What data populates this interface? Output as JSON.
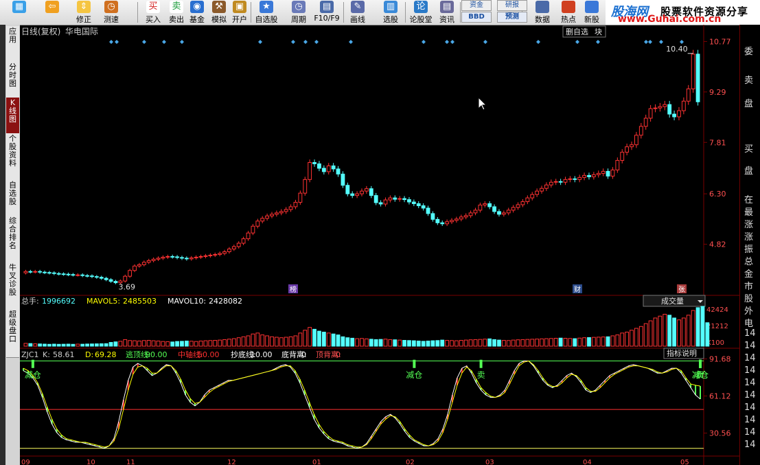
{
  "toolbar": {
    "buttons": [
      {
        "label": "",
        "icon": "window-grid-icon"
      },
      {
        "label": "",
        "icon": "back-arrow-icon"
      },
      {
        "label": "修正",
        "icon": "arrows-updown-icon"
      },
      {
        "label": "测速",
        "icon": "clock-icon"
      },
      {
        "label": "买入",
        "icon": "buy-icon"
      },
      {
        "label": "卖出",
        "icon": "sell-icon"
      },
      {
        "label": "基金",
        "icon": "fund-icon"
      },
      {
        "label": "模拟",
        "icon": "hammer-icon"
      },
      {
        "label": "开户",
        "icon": "lock-icon"
      },
      {
        "label": "自选股",
        "icon": "star-icon"
      },
      {
        "label": "周期",
        "icon": "cycle-clock-icon"
      },
      {
        "label": "F10/F9",
        "icon": "report-icon"
      },
      {
        "label": "画线",
        "icon": "pencil-icon"
      },
      {
        "label": "选股",
        "icon": "stock-pick-icon"
      },
      {
        "label": "论股堂",
        "icon": "forum-icon"
      },
      {
        "label": "资讯",
        "icon": "news-icon"
      }
    ],
    "stacked": [
      {
        "top": "资金",
        "bottom": "BBD"
      },
      {
        "top": "研报",
        "bottom": "预测"
      }
    ],
    "tail": [
      {
        "label": "数据",
        "icon": "pe-data-icon"
      },
      {
        "label": "热点",
        "icon": "hot-icon"
      },
      {
        "label": "新股",
        "icon": "new-stock-icon"
      }
    ],
    "brand": {
      "logo": "股海网",
      "slogan": "股票软件资源分享",
      "url": "www.Guhai.com.cn"
    }
  },
  "sidebar": {
    "items": [
      {
        "label": "应用",
        "active": false
      },
      {
        "label": "分时图",
        "active": false
      },
      {
        "label": "K线图",
        "active": true
      },
      {
        "label": "个股资料",
        "active": false
      },
      {
        "label": "自选股",
        "active": false
      },
      {
        "label": "综合排名",
        "active": false
      },
      {
        "label": "牛叉诊股",
        "active": false
      },
      {
        "label": "超级盘口",
        "active": false
      }
    ]
  },
  "chart_header": {
    "period": "日线(复权)",
    "stock_name": "华电国际",
    "delete_fav": "删自选",
    "market_suffix": "块"
  },
  "rightpanel": {
    "chars": [
      "委",
      "卖",
      "盘",
      "买",
      "盘",
      "在",
      "最",
      "涨",
      "涨",
      "振",
      "总",
      "金",
      "市",
      "股",
      "外",
      "电"
    ]
  },
  "price_axis": {
    "labels": [
      "10.77",
      "9.29",
      "7.81",
      "6.30",
      "4.82"
    ]
  },
  "price_annotations": {
    "high": "10.40",
    "low": "3.69"
  },
  "markers": {
    "bang": "榜",
    "cai": "财",
    "zhang": "张"
  },
  "volume_panel": {
    "total_label": "总手:",
    "total_value": "1996692",
    "mavol5_label": "MAVOL5:",
    "mavol5_value": "2485503",
    "mavol10_label": "MAVOL10:",
    "mavol10_value": "2428082",
    "selector": "成交量",
    "axis": [
      "42424",
      "21212",
      "X100"
    ]
  },
  "indicator_panel": {
    "name": "ZJC1",
    "k_label": "K:",
    "k_value": "58.61",
    "d_label": "D:",
    "d_value": "69.28",
    "escape_label": "逃顶线:",
    "escape_value": "90.00",
    "mid_label": "中轴线:",
    "mid_value": "50.00",
    "bottom_label": "抄底线:",
    "bottom_value": "10.00",
    "dib_label": "底背离:",
    "dib_value": "0",
    "dingb_label": "顶背离:",
    "dingb_value": "0",
    "help": "指标说明",
    "axis": [
      "91.68",
      "61.12",
      "30.56"
    ],
    "signals": [
      "减仓",
      "减仓",
      "卖",
      "卖",
      "减仓",
      "卖",
      "减仓"
    ]
  },
  "right_axis_rows": [
    "14",
    "14",
    "14",
    "14",
    "14",
    "14",
    "14",
    "14",
    "14",
    "14"
  ],
  "x_axis": {
    "labels": [
      "09",
      "10",
      "11",
      "12",
      "01",
      "02",
      "03",
      "04",
      "05"
    ]
  },
  "colors": {
    "up": "#ff3232",
    "down": "#54ffff",
    "grid": "#7a0000",
    "ma5": "#ffffff",
    "ma10": "#ffff00"
  },
  "chart_data": {
    "type": "candlestick",
    "price_range": [
      3.4,
      10.9
    ],
    "volume_range": [
      0,
      42424
    ],
    "indicator_range": [
      15,
      92
    ],
    "close_series": [
      4.02,
      4.01,
      4.02,
      4.0,
      3.99,
      3.98,
      3.96,
      3.95,
      3.94,
      3.93,
      3.92,
      3.92,
      3.9,
      3.89,
      3.87,
      3.85,
      3.82,
      3.78,
      3.73,
      3.69,
      3.74,
      3.88,
      4.05,
      4.18,
      4.22,
      4.29,
      4.34,
      4.38,
      4.41,
      4.44,
      4.46,
      4.45,
      4.43,
      4.41,
      4.39,
      4.42,
      4.44,
      4.46,
      4.48,
      4.5,
      4.52,
      4.55,
      4.6,
      4.68,
      4.75,
      4.85,
      4.98,
      5.15,
      5.35,
      5.5,
      5.58,
      5.65,
      5.7,
      5.74,
      5.78,
      5.84,
      5.92,
      6.05,
      6.32,
      6.72,
      7.22,
      7.18,
      7.05,
      6.95,
      7.12,
      7.03,
      6.88,
      6.55,
      6.3,
      6.25,
      6.3,
      6.38,
      6.45,
      6.25,
      6.04,
      6.0,
      6.12,
      6.18,
      6.14,
      6.16,
      6.13,
      6.06,
      6.01,
      5.95,
      5.88,
      5.72,
      5.55,
      5.45,
      5.42,
      5.48,
      5.52,
      5.56,
      5.62,
      5.66,
      5.74,
      5.82,
      5.97,
      6.01,
      5.92,
      5.78,
      5.7,
      5.74,
      5.82,
      5.9,
      5.98,
      6.07,
      6.18,
      6.28,
      6.38,
      6.46,
      6.56,
      6.64,
      6.66,
      6.64,
      6.72,
      6.74,
      6.72,
      6.78,
      6.84,
      6.8,
      6.86,
      6.9,
      6.96,
      6.82,
      7.0,
      7.28,
      7.52,
      7.68,
      7.74,
      8.02,
      8.28,
      8.52,
      8.8,
      8.82,
      8.86,
      8.92,
      8.64,
      8.56,
      8.74,
      9.02,
      9.38,
      10.4,
      9.0
    ],
    "volume_series": [
      30,
      28,
      25,
      24,
      22,
      20,
      22,
      20,
      21,
      22,
      20,
      22,
      21,
      23,
      24,
      25,
      26,
      27,
      40,
      46,
      52,
      70,
      60,
      58,
      55,
      60,
      62,
      58,
      55,
      50,
      48,
      45,
      50,
      52,
      55,
      53,
      50,
      55,
      58,
      60,
      62,
      65,
      70,
      75,
      80,
      90,
      100,
      110,
      130,
      140,
      120,
      110,
      100,
      95,
      90,
      95,
      100,
      110,
      140,
      170,
      200,
      180,
      160,
      150,
      140,
      130,
      120,
      100,
      90,
      85,
      80,
      82,
      78,
      74,
      70,
      72,
      75,
      70,
      68,
      65,
      62,
      60,
      58,
      55,
      52,
      55,
      58,
      60,
      65,
      62,
      60,
      58,
      62,
      65,
      68,
      70,
      72,
      75,
      78,
      70,
      65,
      62,
      60,
      65,
      68,
      70,
      72,
      74,
      76,
      78,
      80,
      82,
      84,
      86,
      84,
      82,
      80,
      86,
      90,
      92,
      94,
      96,
      98,
      100,
      110,
      120,
      140,
      150,
      170,
      190,
      210,
      240,
      270,
      300,
      320,
      340,
      330,
      300,
      280,
      300,
      330,
      380,
      410,
      424,
      250
    ],
    "k_series": [
      82,
      80,
      76,
      70,
      60,
      48,
      38,
      31,
      27,
      25,
      24,
      23,
      23,
      22,
      21,
      20,
      19,
      18,
      20,
      26,
      40,
      58,
      74,
      85,
      88,
      86,
      82,
      78,
      80,
      84,
      87,
      86,
      80,
      72,
      62,
      56,
      53,
      56,
      62,
      66,
      68,
      70,
      72,
      74,
      74,
      75,
      76,
      77,
      78,
      79,
      80,
      81,
      82,
      84,
      86,
      87,
      85,
      80,
      72,
      62,
      52,
      42,
      35,
      30,
      26,
      24,
      23,
      22,
      20,
      19,
      18,
      19,
      22,
      28,
      34,
      40,
      44,
      46,
      43,
      38,
      32,
      27,
      24,
      22,
      20,
      20,
      22,
      26,
      34,
      46,
      62,
      76,
      84,
      86,
      80,
      72,
      66,
      62,
      60,
      60,
      62,
      66,
      74,
      82,
      88,
      90,
      90,
      86,
      80,
      74,
      70,
      68,
      70,
      74,
      78,
      80,
      77,
      72,
      66,
      64,
      66,
      70,
      74,
      78,
      80,
      82,
      84,
      86,
      87,
      86,
      85,
      84,
      82,
      80,
      80,
      82,
      84,
      84,
      80,
      74,
      68,
      62,
      58.61
    ],
    "d_series": [
      84,
      82,
      78,
      72,
      63,
      52,
      42,
      34,
      29,
      26,
      25,
      24,
      23,
      23,
      22,
      21,
      20,
      19,
      20,
      24,
      34,
      50,
      66,
      79,
      85,
      86,
      84,
      80,
      80,
      83,
      86,
      86,
      82,
      75,
      66,
      59,
      55,
      56,
      60,
      64,
      67,
      69,
      71,
      73,
      74,
      75,
      76,
      77,
      78,
      79,
      80,
      81,
      82,
      83,
      85,
      86,
      86,
      82,
      75,
      66,
      56,
      46,
      38,
      32,
      28,
      25,
      24,
      23,
      21,
      20,
      19,
      19,
      21,
      26,
      32,
      38,
      42,
      45,
      44,
      40,
      34,
      29,
      25,
      23,
      21,
      20,
      21,
      24,
      31,
      42,
      56,
      70,
      80,
      85,
      82,
      75,
      68,
      64,
      61,
      60,
      61,
      64,
      71,
      79,
      86,
      89,
      90,
      87,
      82,
      76,
      71,
      69,
      69,
      72,
      76,
      79,
      78,
      74,
      68,
      65,
      65,
      68,
      72,
      76,
      79,
      81,
      83,
      85,
      86,
      86,
      85,
      84,
      83,
      81,
      80,
      81,
      83,
      84,
      82,
      76,
      71,
      70,
      69.28
    ],
    "signal_positions": [
      2,
      82,
      96,
      235,
      255,
      275,
      283
    ],
    "x_tick_labels": [
      "09",
      "10",
      "11",
      "12",
      "01",
      "02",
      "03",
      "04",
      "05"
    ]
  }
}
